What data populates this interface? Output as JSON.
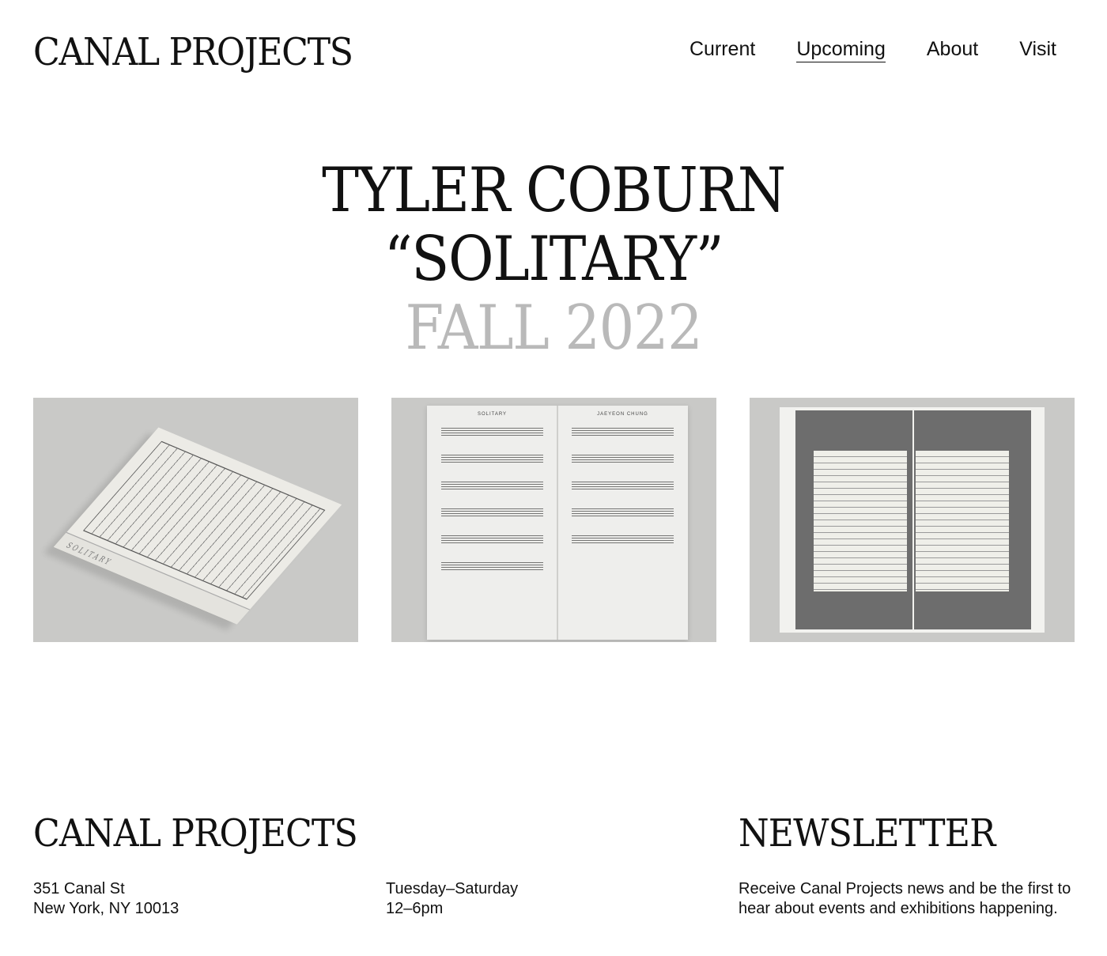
{
  "header": {
    "logo": "CANAL PROJECTS",
    "nav": [
      {
        "label": "Current",
        "active": false
      },
      {
        "label": "Upcoming",
        "active": true
      },
      {
        "label": "About",
        "active": false
      },
      {
        "label": "Visit",
        "active": false
      }
    ]
  },
  "hero": {
    "artist": "TYLER COBURN",
    "title": "“SOLITARY”",
    "date": "FALL 2022"
  },
  "gallery": {
    "box_label": "SOLITARY",
    "score_left_head": "SOLITARY",
    "score_right_head": "JAEYEON CHUNG"
  },
  "footer": {
    "logo": "CANAL PROJECTS",
    "address_line1": "351 Canal St",
    "address_line2": "New York, NY 10013",
    "hours_line1": "Tuesday–Saturday",
    "hours_line2": "12–6pm",
    "newsletter_title": "NEWSLETTER",
    "newsletter_text": "Receive Canal Projects news and be the first to hear about events and exhibitions happening."
  },
  "colors": {
    "text": "#111111",
    "date_gray": "#b9b9b9",
    "background": "#ffffff"
  }
}
